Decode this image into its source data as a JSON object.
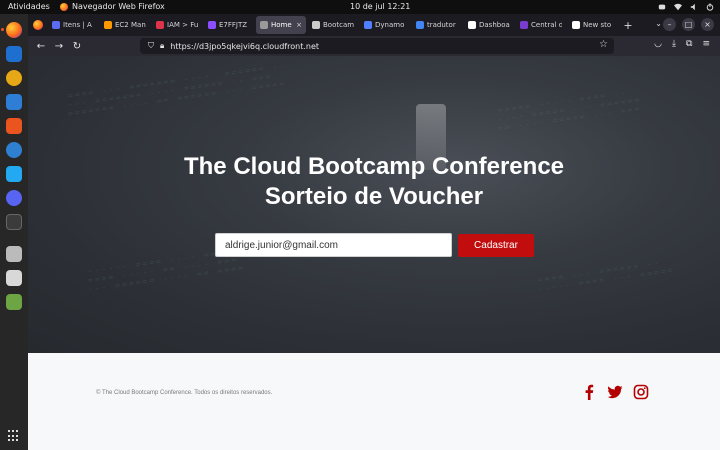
{
  "topbar": {
    "activities": "Atividades",
    "app_name": "Navegador Web Firefox",
    "clock": "10 de jul  12:21"
  },
  "browser": {
    "tabs": [
      {
        "label": "Itens | A",
        "favicon_color": "#5b6cf0"
      },
      {
        "label": "EC2 Man",
        "favicon_color": "#ff9900"
      },
      {
        "label": "IAM > Fu",
        "favicon_color": "#dd344c"
      },
      {
        "label": "E7FFJTZ",
        "favicon_color": "#8c4fff"
      },
      {
        "label": "Home - Th",
        "favicon_color": "#9a9a9a",
        "active": true
      },
      {
        "label": "Bootcam",
        "favicon_color": "#cccccc"
      },
      {
        "label": "Dynamo",
        "favicon_color": "#527fff"
      },
      {
        "label": "tradutor",
        "favicon_color": "#4285f4"
      },
      {
        "label": "Dashboa",
        "favicon_color": "#ffffff"
      },
      {
        "label": "Central d",
        "favicon_color": "#7a3ccf"
      },
      {
        "label": "New sto",
        "favicon_color": "#ffffff"
      }
    ],
    "url": "https://d3jpo5qkejvi6q.cloudfront.net"
  },
  "page": {
    "title_line1": "The Cloud Bootcamp Conference",
    "title_line2": "Sorteio de Voucher",
    "email_value": "aldrige.junior@gmail.com",
    "submit_label": "Cadastrar",
    "footer_copy": "© The Cloud Bootcamp Conference. Todos os direitos reservados."
  },
  "colors": {
    "accent": "#c10d0d",
    "hero_bg": "#2c3036",
    "footer_bg": "#f7f8fa"
  },
  "icons": [
    "firefox-icon",
    "facebook-icon",
    "twitter-icon",
    "instagram-icon"
  ]
}
